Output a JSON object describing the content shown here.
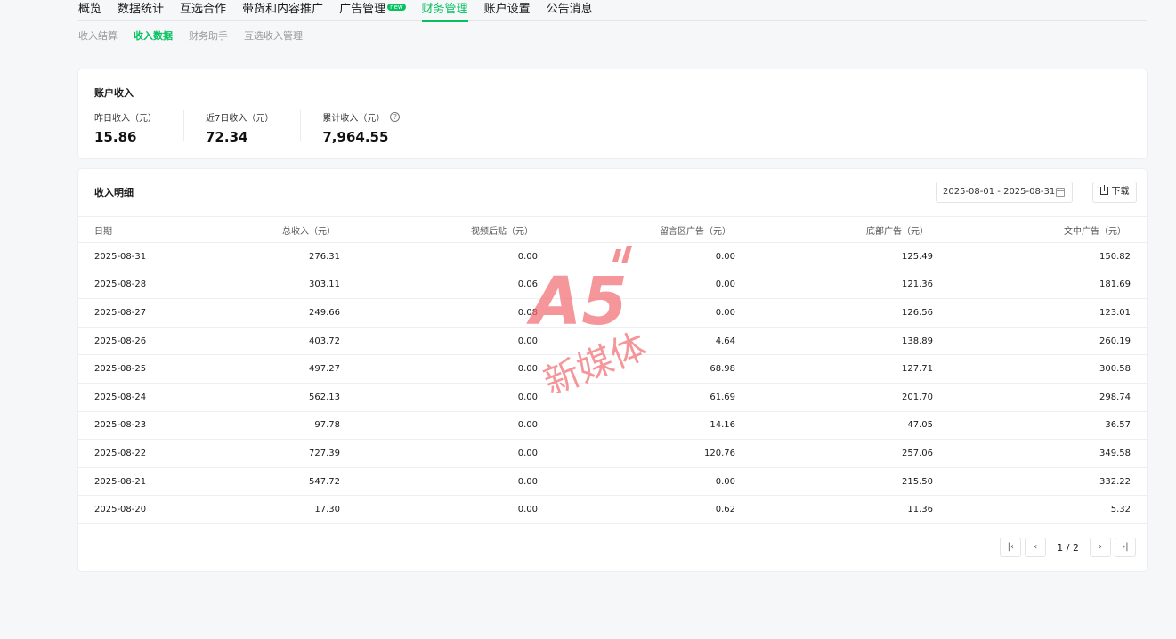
{
  "nav": {
    "items": [
      "概览",
      "数据统计",
      "互选合作",
      "带货和内容推广",
      "广告管理",
      "财务管理",
      "账户设置",
      "公告消息"
    ],
    "badge": "new",
    "active_index": 5
  },
  "subnav": {
    "items": [
      "收入结算",
      "收入数据",
      "财务助手",
      "互选收入管理"
    ],
    "active_index": 1
  },
  "summary": {
    "title": "账户收入",
    "metrics": [
      {
        "label": "昨日收入（元）",
        "value": "15.86"
      },
      {
        "label": "近7日收入（元）",
        "value": "72.34"
      },
      {
        "label": "累计收入（元）",
        "value": "7,964.55"
      }
    ]
  },
  "detail": {
    "title": "收入明细",
    "date_range": "2025-08-01 - 2025-08-31",
    "download_label": "下载",
    "columns": [
      "日期",
      "总收入（元）",
      "视频后贴（元）",
      "留言区广告（元）",
      "底部广告（元）",
      "文中广告（元）"
    ],
    "rows": [
      [
        "2025-08-31",
        "276.31",
        "0.00",
        "0.00",
        "125.49",
        "150.82"
      ],
      [
        "2025-08-28",
        "303.11",
        "0.06",
        "0.00",
        "121.36",
        "181.69"
      ],
      [
        "2025-08-27",
        "249.66",
        "0.08",
        "0.00",
        "126.56",
        "123.01"
      ],
      [
        "2025-08-26",
        "403.72",
        "0.00",
        "4.64",
        "138.89",
        "260.19"
      ],
      [
        "2025-08-25",
        "497.27",
        "0.00",
        "68.98",
        "127.71",
        "300.58"
      ],
      [
        "2025-08-24",
        "562.13",
        "0.00",
        "61.69",
        "201.70",
        "298.74"
      ],
      [
        "2025-08-23",
        "97.78",
        "0.00",
        "14.16",
        "47.05",
        "36.57"
      ],
      [
        "2025-08-22",
        "727.39",
        "0.00",
        "120.76",
        "257.06",
        "349.58"
      ],
      [
        "2025-08-21",
        "547.72",
        "0.00",
        "0.00",
        "215.50",
        "332.22"
      ],
      [
        "2025-08-20",
        "17.30",
        "0.00",
        "0.62",
        "11.36",
        "5.32"
      ]
    ],
    "pagination": {
      "text": "1 / 2"
    }
  },
  "watermark": {
    "mark": "A5",
    "text": "新媒体"
  },
  "colors": {
    "accent": "#07c160",
    "watermark": "#f26b70"
  }
}
